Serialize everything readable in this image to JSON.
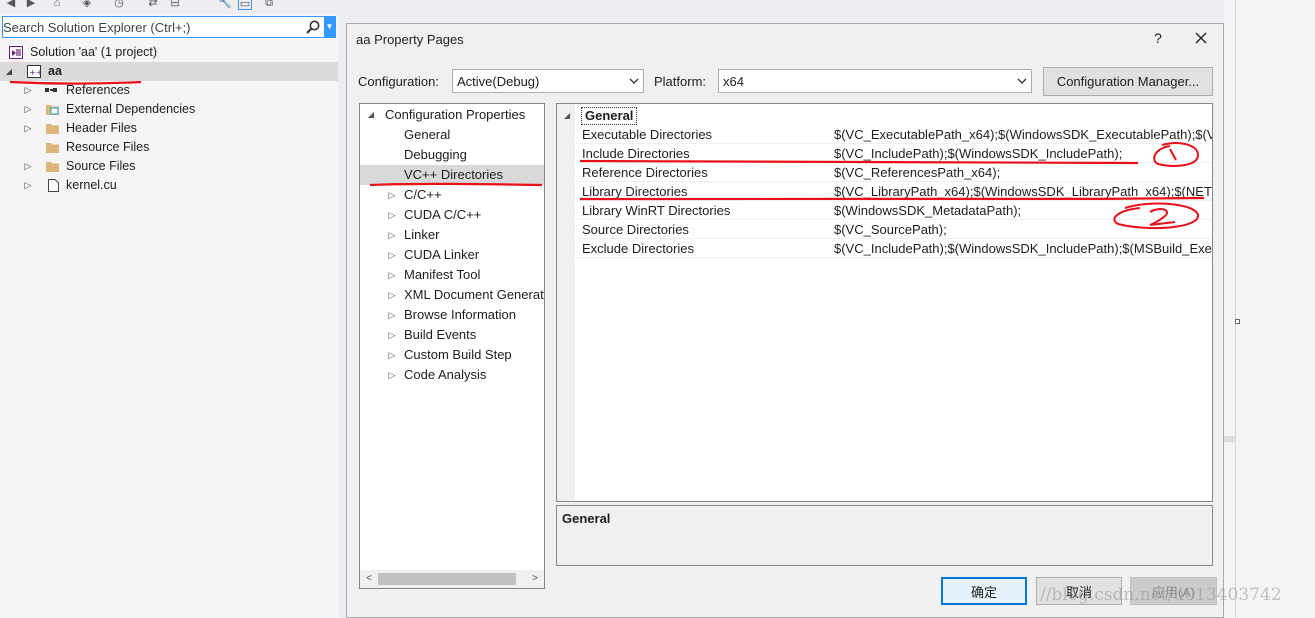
{
  "solution_explorer": {
    "search_placeholder": "Search Solution Explorer (Ctrl+;)",
    "solution_label": "Solution 'aa' (1 project)",
    "project_label": "aa",
    "items": [
      {
        "label": "References",
        "icon": "references-icon"
      },
      {
        "label": "External Dependencies",
        "icon": "external-deps-icon"
      },
      {
        "label": "Header Files",
        "icon": "folder-icon"
      },
      {
        "label": "Resource Files",
        "icon": "folder-icon"
      },
      {
        "label": "Source Files",
        "icon": "folder-icon"
      },
      {
        "label": "kernel.cu",
        "icon": "file-icon"
      }
    ]
  },
  "dialog": {
    "title": "aa Property Pages",
    "help": "?",
    "configuration_label": "Configuration:",
    "configuration_value": "Active(Debug)",
    "platform_label": "Platform:",
    "platform_value": "x64",
    "config_manager_label": "Configuration Manager...",
    "nav": {
      "root": "Configuration Properties",
      "items": [
        {
          "label": "General",
          "expandable": false
        },
        {
          "label": "Debugging",
          "expandable": false
        },
        {
          "label": "VC++ Directories",
          "expandable": false,
          "selected": true
        },
        {
          "label": "C/C++",
          "expandable": true
        },
        {
          "label": "CUDA C/C++",
          "expandable": true
        },
        {
          "label": "Linker",
          "expandable": true
        },
        {
          "label": "CUDA Linker",
          "expandable": true
        },
        {
          "label": "Manifest Tool",
          "expandable": true
        },
        {
          "label": "XML Document Generat",
          "expandable": true
        },
        {
          "label": "Browse Information",
          "expandable": true
        },
        {
          "label": "Build Events",
          "expandable": true
        },
        {
          "label": "Custom Build Step",
          "expandable": true
        },
        {
          "label": "Code Analysis",
          "expandable": true
        }
      ]
    },
    "grid": {
      "category": "General",
      "rows": [
        {
          "name": "Executable Directories",
          "value": "$(VC_ExecutablePath_x64);$(WindowsSDK_ExecutablePath);$(VS_ExecutablePath)"
        },
        {
          "name": "Include Directories",
          "value": "$(VC_IncludePath);$(WindowsSDK_IncludePath);"
        },
        {
          "name": "Reference Directories",
          "value": "$(VC_ReferencesPath_x64);"
        },
        {
          "name": "Library Directories",
          "value": "$(VC_LibraryPath_x64);$(WindowsSDK_LibraryPath_x64);$(NETFXKitsDir)"
        },
        {
          "name": "Library WinRT Directories",
          "value": "$(WindowsSDK_MetadataPath);"
        },
        {
          "name": "Source Directories",
          "value": "$(VC_SourcePath);"
        },
        {
          "name": "Exclude Directories",
          "value": "$(VC_IncludePath);$(WindowsSDK_IncludePath);$(MSBuild_ExecutablePath)"
        }
      ]
    },
    "description_title": "General",
    "buttons": {
      "ok": "确定",
      "cancel": "取消",
      "apply": "应用(A)"
    }
  },
  "watermark": "//blog.csdn.net/u013403742"
}
